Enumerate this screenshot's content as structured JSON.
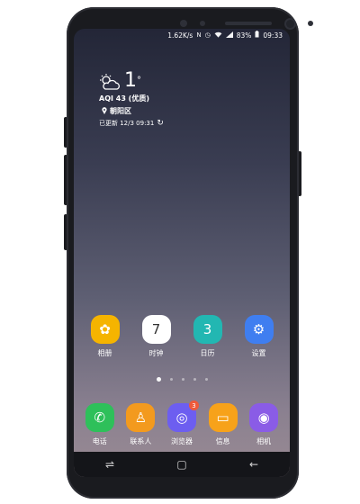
{
  "status_bar": {
    "net_speed": "1.62K/s",
    "icons": [
      "nfc-icon",
      "alarm-icon",
      "wifi-icon",
      "signal-4g-icon",
      "battery-icon"
    ],
    "battery": "83%",
    "time": "09:33"
  },
  "weather": {
    "temperature": "1",
    "degree": "°",
    "aqi": "AQI 43 (优质)",
    "location": "朝阳区",
    "updated": "已更新 12/3 09:31"
  },
  "home_apps": [
    {
      "label": "相册",
      "color": "#f5b400",
      "icon": "gallery-flower-icon",
      "glyph": "✿"
    },
    {
      "label": "时钟",
      "color": "#ffffff",
      "icon": "clock-icon",
      "glyph": "7"
    },
    {
      "label": "日历",
      "color": "#22b7b2",
      "icon": "calendar-icon",
      "glyph": "3"
    },
    {
      "label": "设置",
      "color": "#3f7ef0",
      "icon": "gear-icon",
      "glyph": "⚙"
    }
  ],
  "page_indicator": {
    "count": 5,
    "active": 0
  },
  "dock_apps": [
    {
      "label": "电话",
      "color": "#2ec05a",
      "icon": "phone-icon",
      "glyph": "✆"
    },
    {
      "label": "联系人",
      "color": "#f39a1e",
      "icon": "contacts-icon",
      "glyph": "♙"
    },
    {
      "label": "浏览器",
      "color": "#6d5ef0",
      "icon": "browser-planet-icon",
      "glyph": "◎",
      "badge": "3"
    },
    {
      "label": "信息",
      "color": "#f7a21a",
      "icon": "message-icon",
      "glyph": "▭"
    },
    {
      "label": "相机",
      "color": "#8a5ce6",
      "icon": "camera-icon",
      "glyph": "◉"
    }
  ],
  "nav_bar": {
    "recents_glyph": "⇌",
    "home_glyph": "▢",
    "back_glyph": "←"
  }
}
